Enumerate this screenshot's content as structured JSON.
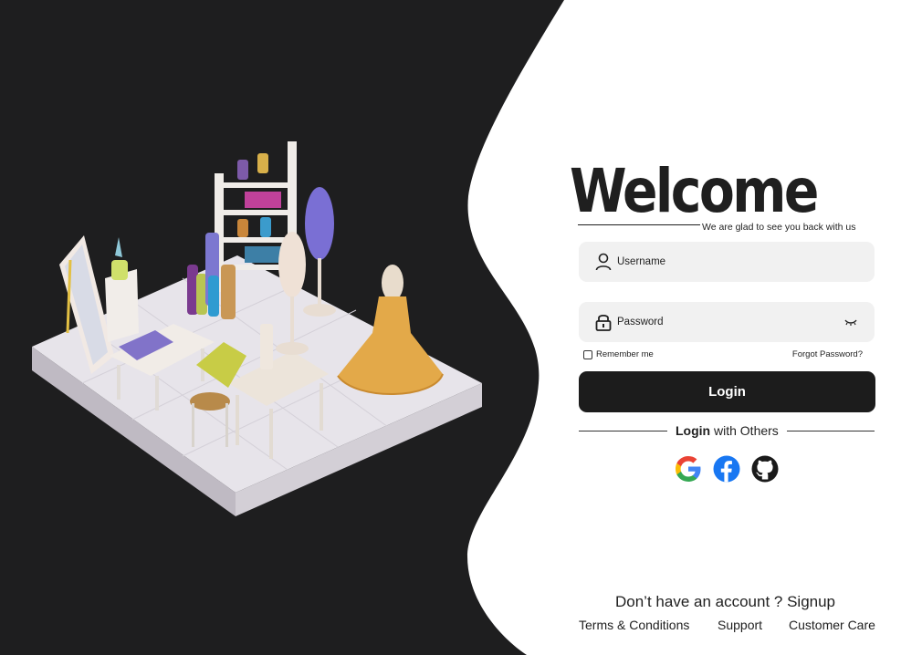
{
  "colors": {
    "dark_panel": "#1e1e1f",
    "background": "#ffffff",
    "field_bg": "#f1f1f1",
    "button_bg": "#1c1c1c",
    "button_text": "#ffffff",
    "text": "#1f1f1f"
  },
  "hero": {
    "title": "Welcome",
    "subtitle": "We are glad to see you back with us"
  },
  "form": {
    "username": {
      "placeholder": "Username",
      "value": "",
      "icon": "user-icon"
    },
    "password": {
      "placeholder": "Password",
      "value": "",
      "icon": "lock-icon",
      "toggle_icon": "eye-closed-icon"
    },
    "remember_label": "Remember me",
    "remember_checked": false,
    "forgot_label": "Forgot Password?",
    "login_label": "Login"
  },
  "social": {
    "prefix": "Login",
    "suffix": " with Others",
    "providers": [
      "google-icon",
      "facebook-icon",
      "github-icon"
    ]
  },
  "signup": {
    "prompt": "Don’t have an account ? ",
    "link": "Signup"
  },
  "footer": {
    "terms": "Terms & Conditions",
    "support": "Support",
    "care": "Customer Care"
  }
}
